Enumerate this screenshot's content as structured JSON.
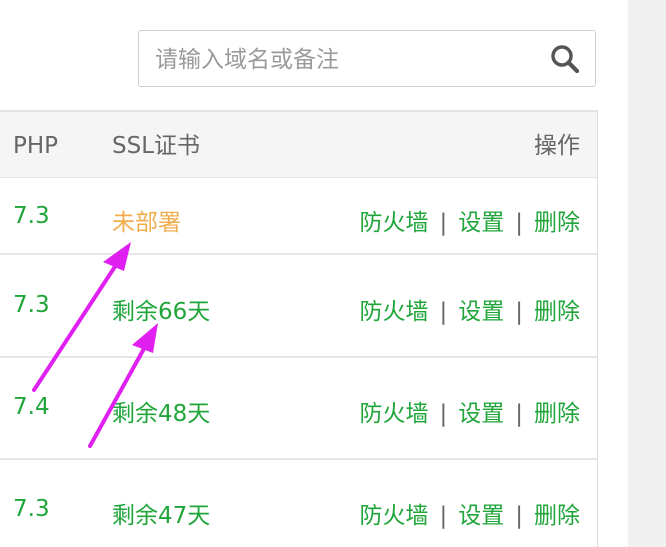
{
  "search": {
    "placeholder": "请输入域名或备注",
    "value": ""
  },
  "table": {
    "headers": {
      "php": "PHP",
      "ssl": "SSL证书",
      "ops": "操作"
    },
    "rows": [
      {
        "php": "7.3",
        "ssl": "未部署",
        "ssl_status": "warn"
      },
      {
        "php": "7.3",
        "ssl": "剩余66天",
        "ssl_status": "ok"
      },
      {
        "php": "7.4",
        "ssl": "剩余48天",
        "ssl_status": "ok"
      },
      {
        "php": "7.3",
        "ssl": "剩余47天",
        "ssl_status": "ok"
      }
    ],
    "actions": {
      "firewall": "防火墙",
      "settings": "设置",
      "delete": "删除",
      "separator": "|"
    }
  },
  "colors": {
    "green": "#20a53a",
    "orange": "#f0ad4e",
    "arrow": "#e020f0"
  },
  "icons": {
    "search": "search-icon"
  }
}
